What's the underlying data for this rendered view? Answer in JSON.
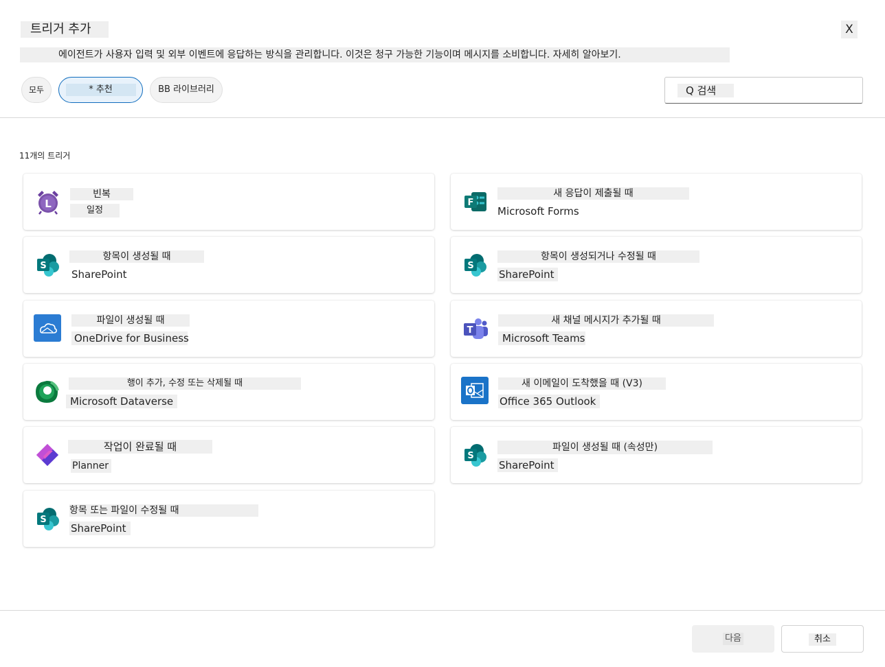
{
  "dialog": {
    "title": "트리거 추가",
    "close_label": "X",
    "description": "에이전트가 사용자 입력 및 외부 이벤트에 응답하는 방식을 관리합니다. 이것은 청구 가능한 기능이며 메시지를 소비합니다. 자세히 알아보기."
  },
  "filters": {
    "all": "모두",
    "recommended": "* 추천",
    "library": "BB 라이브러리"
  },
  "search": {
    "label": "Q 검색"
  },
  "trigger_count": "11개의 트리거",
  "triggers": [
    {
      "title": "빈복",
      "source": "일정",
      "icon": "alarm-clock-icon"
    },
    {
      "title": "새 응답이 제출될 때",
      "source": "Microsoft Forms",
      "icon": "forms-icon"
    },
    {
      "title": "항목이 생성될 때",
      "source": "SharePoint",
      "icon": "sharepoint-icon"
    },
    {
      "title": "항목이 생성되거나 수정될 때",
      "source": "SharePoint",
      "icon": "sharepoint-icon"
    },
    {
      "title": "파일이 생성될 때",
      "source": "OneDrive for Business",
      "icon": "onedrive-icon"
    },
    {
      "title": "새 채널 메시지가 추가될 때",
      "source": "Microsoft Teams",
      "icon": "teams-icon"
    },
    {
      "title": "행이 추가, 수정 또는 삭제될 때",
      "source": "Microsoft Dataverse",
      "icon": "dataverse-icon"
    },
    {
      "title": "새 이메일이 도착했을 때 (V3)",
      "source": "Office 365 Outlook",
      "icon": "outlook-icon"
    },
    {
      "title": "작업이 완료될 때",
      "source": "Planner",
      "icon": "planner-icon"
    },
    {
      "title": "파일이 생성될 때 (속성만)",
      "source": "SharePoint",
      "icon": "sharepoint-icon"
    },
    {
      "title": "항목 또는 파일이 수정될 때",
      "source": "SharePoint",
      "icon": "sharepoint-icon"
    }
  ],
  "footer": {
    "next_label": "다음",
    "cancel_label": "취소"
  },
  "colors": {
    "accent": "#0f6cbd",
    "sharepoint": "#038387",
    "onedrive": "#2b7cd3",
    "outlook": "#1a73c8",
    "teams": "#5b5fc7",
    "forms": "#0e7a75"
  }
}
